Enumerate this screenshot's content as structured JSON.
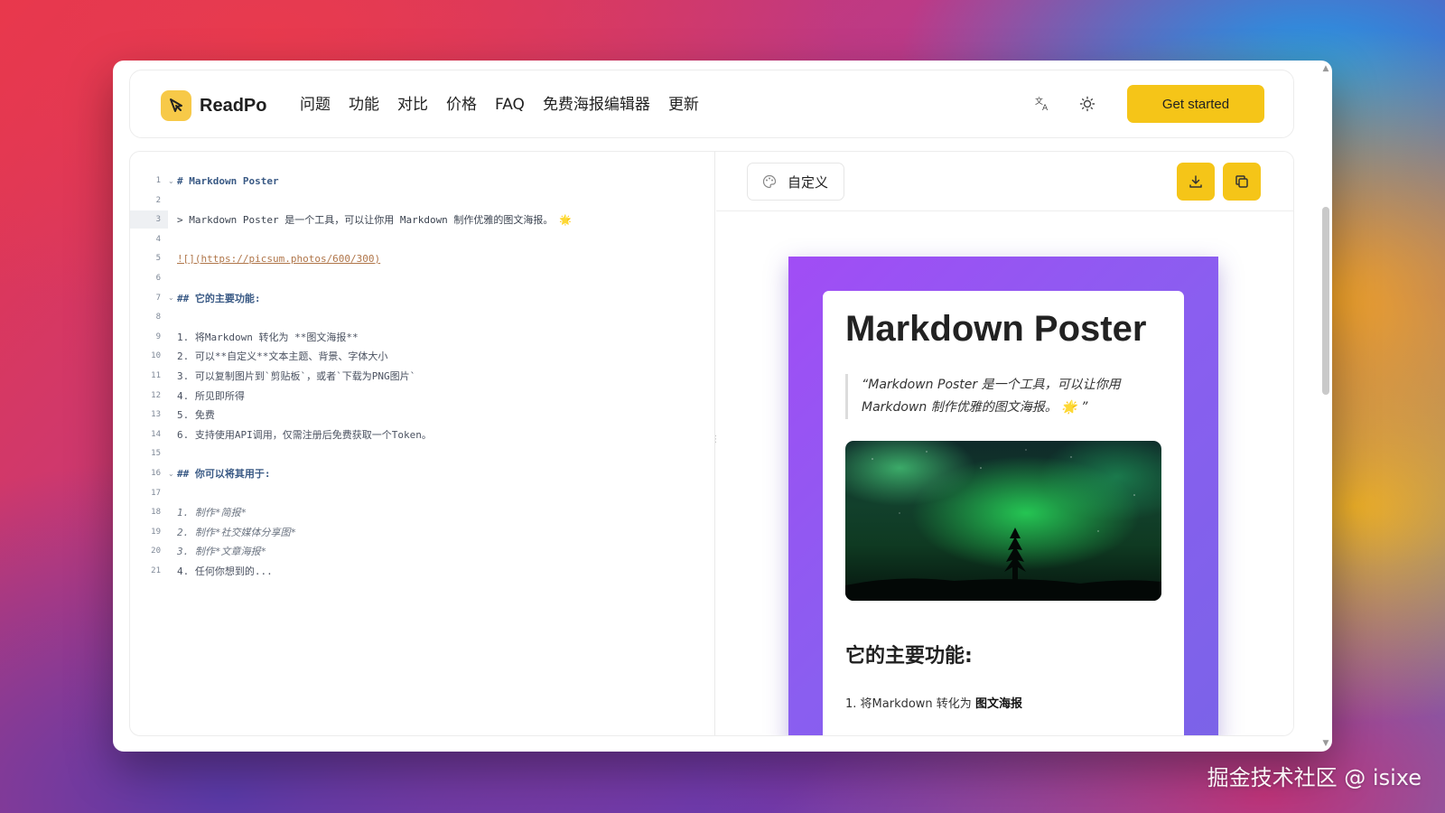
{
  "app": {
    "logo_text": "ReadPo",
    "nav": [
      "问题",
      "功能",
      "对比",
      "价格",
      "FAQ",
      "免费海报编辑器",
      "更新"
    ],
    "cta_label": "Get started",
    "icons": {
      "translate": "translate-icon",
      "theme": "sun-icon"
    }
  },
  "editor": {
    "active_line": 3,
    "lines": [
      {
        "n": "1",
        "fold": true,
        "text": "# Markdown Poster",
        "kind": "heading"
      },
      {
        "n": "2",
        "fold": false,
        "text": "",
        "kind": "plain"
      },
      {
        "n": "3",
        "fold": false,
        "text": "> Markdown Poster 是一个工具，可以让你用 Markdown 制作优雅的图文海报。 🌟",
        "kind": "plain"
      },
      {
        "n": "4",
        "fold": false,
        "text": "",
        "kind": "plain"
      },
      {
        "n": "5",
        "fold": false,
        "text": "![](https://picsum.photos/600/300)",
        "kind": "link"
      },
      {
        "n": "6",
        "fold": false,
        "text": "",
        "kind": "plain"
      },
      {
        "n": "7",
        "fold": true,
        "text": "## 它的主要功能:",
        "kind": "heading"
      },
      {
        "n": "8",
        "fold": false,
        "text": "",
        "kind": "plain"
      },
      {
        "n": "9",
        "fold": false,
        "text": "1. 将Markdown 转化为 **图文海报**",
        "kind": "list"
      },
      {
        "n": "10",
        "fold": false,
        "text": "2. 可以**自定义**文本主题、背景、字体大小",
        "kind": "list"
      },
      {
        "n": "11",
        "fold": false,
        "text": "3. 可以复制图片到`剪贴板`，或者`下载为PNG图片`",
        "kind": "list"
      },
      {
        "n": "12",
        "fold": false,
        "text": "4. 所见即所得",
        "kind": "list"
      },
      {
        "n": "13",
        "fold": false,
        "text": "5. 免费",
        "kind": "list"
      },
      {
        "n": "14",
        "fold": false,
        "text": "6. 支持使用API调用，仅需注册后免费获取一个Token。",
        "kind": "list"
      },
      {
        "n": "15",
        "fold": false,
        "text": "",
        "kind": "plain"
      },
      {
        "n": "16",
        "fold": true,
        "text": "## 你可以将其用于:",
        "kind": "heading"
      },
      {
        "n": "17",
        "fold": false,
        "text": "",
        "kind": "plain"
      },
      {
        "n": "18",
        "fold": false,
        "text": "1. 制作*简报*",
        "kind": "italic"
      },
      {
        "n": "19",
        "fold": false,
        "text": "2. 制作*社交媒体分享图*",
        "kind": "italic"
      },
      {
        "n": "20",
        "fold": false,
        "text": "3. 制作*文章海报*",
        "kind": "italic"
      },
      {
        "n": "21",
        "fold": false,
        "text": "4. 任何你想到的...",
        "kind": "list"
      }
    ]
  },
  "preview": {
    "customize_label": "自定义",
    "download_icon": "download-icon",
    "copy_icon": "copy-icon",
    "poster": {
      "title": "Markdown Poster",
      "quote": "“Markdown Poster 是一个工具，可以让你用 Markdown 制作优雅的图文海报。 🌟 ”",
      "h2": "它的主要功能:",
      "first_item_prefix": "1.  将Markdown 转化为 ",
      "first_item_bold": "图文海报"
    }
  },
  "watermark": "掘金技术社区 @ isixe"
}
